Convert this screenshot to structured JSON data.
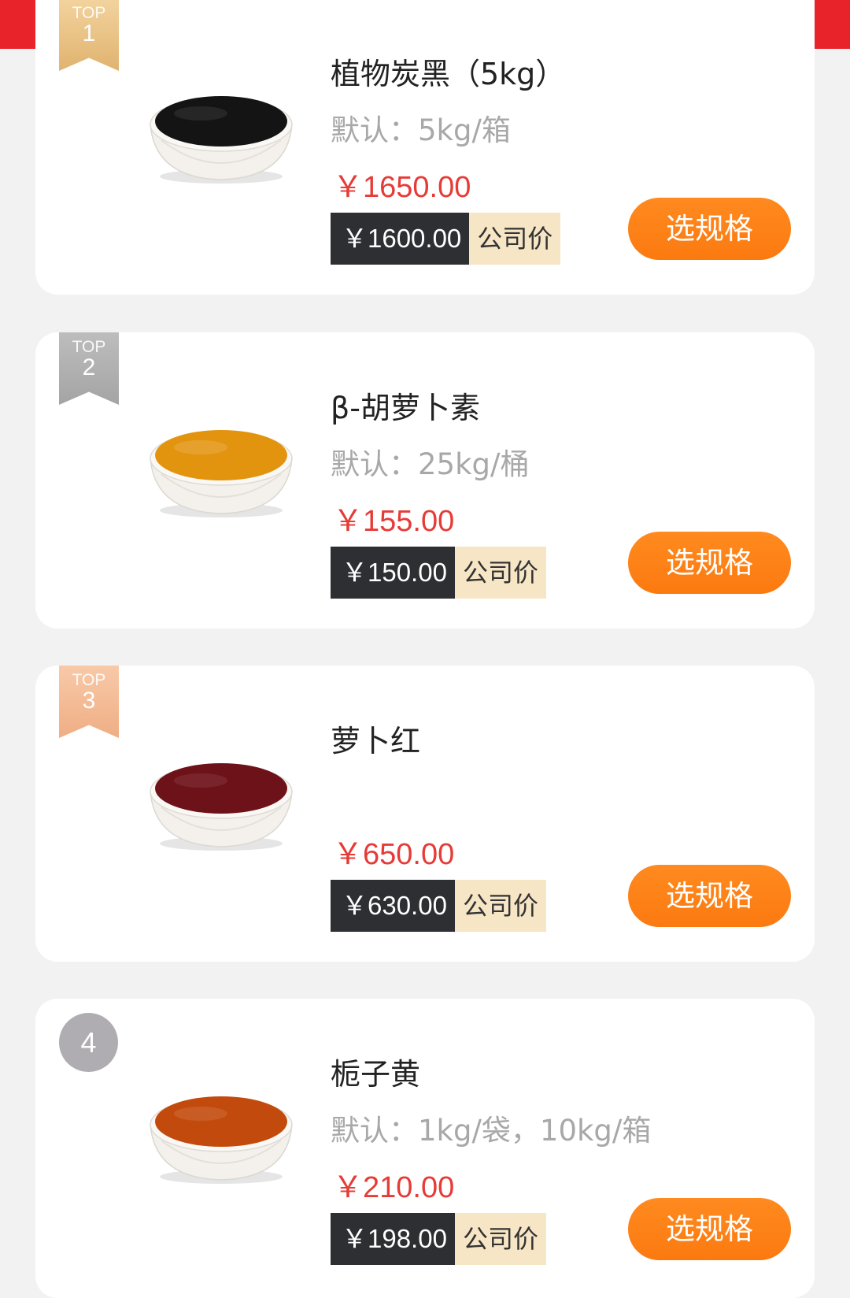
{
  "colors": {
    "background": "#f2f2f2",
    "header_red": "#e8232a",
    "price_red": "#e63b36",
    "button_orange": "#fb7a10",
    "company_price_bg": "#2d2f33",
    "company_label_bg": "#f7e6c6",
    "top1_gold": "#e0b36f",
    "top2_silver": "#a4a4a4",
    "top3_bronze": "#efae84",
    "rank4_gray": "#b0adb2"
  },
  "products": [
    {
      "rank_top": "TOP",
      "rank_num": "1",
      "title": "植物炭黑（5kg）",
      "spec": "默认：5kg/箱",
      "price": "￥1650.00",
      "company_price": "￥1600.00",
      "company_label": "公司价",
      "button": "选规格",
      "powder_color": "#141414"
    },
    {
      "rank_top": "TOP",
      "rank_num": "2",
      "title": "β-胡萝卜素",
      "spec": "默认：25kg/桶",
      "price": "￥155.00",
      "company_price": "￥150.00",
      "company_label": "公司价",
      "button": "选规格",
      "powder_color": "#e3940f"
    },
    {
      "rank_top": "TOP",
      "rank_num": "3",
      "title": "萝卜红",
      "spec": "",
      "price": "￥650.00",
      "company_price": "￥630.00",
      "company_label": "公司价",
      "button": "选规格",
      "powder_color": "#6e1219"
    },
    {
      "rank_num": "4",
      "title": "栀子黄",
      "spec": "默认：1kg/袋，10kg/箱",
      "price": "￥210.00",
      "company_price": "￥198.00",
      "company_label": "公司价",
      "button": "选规格",
      "powder_color": "#c24a0c"
    }
  ]
}
